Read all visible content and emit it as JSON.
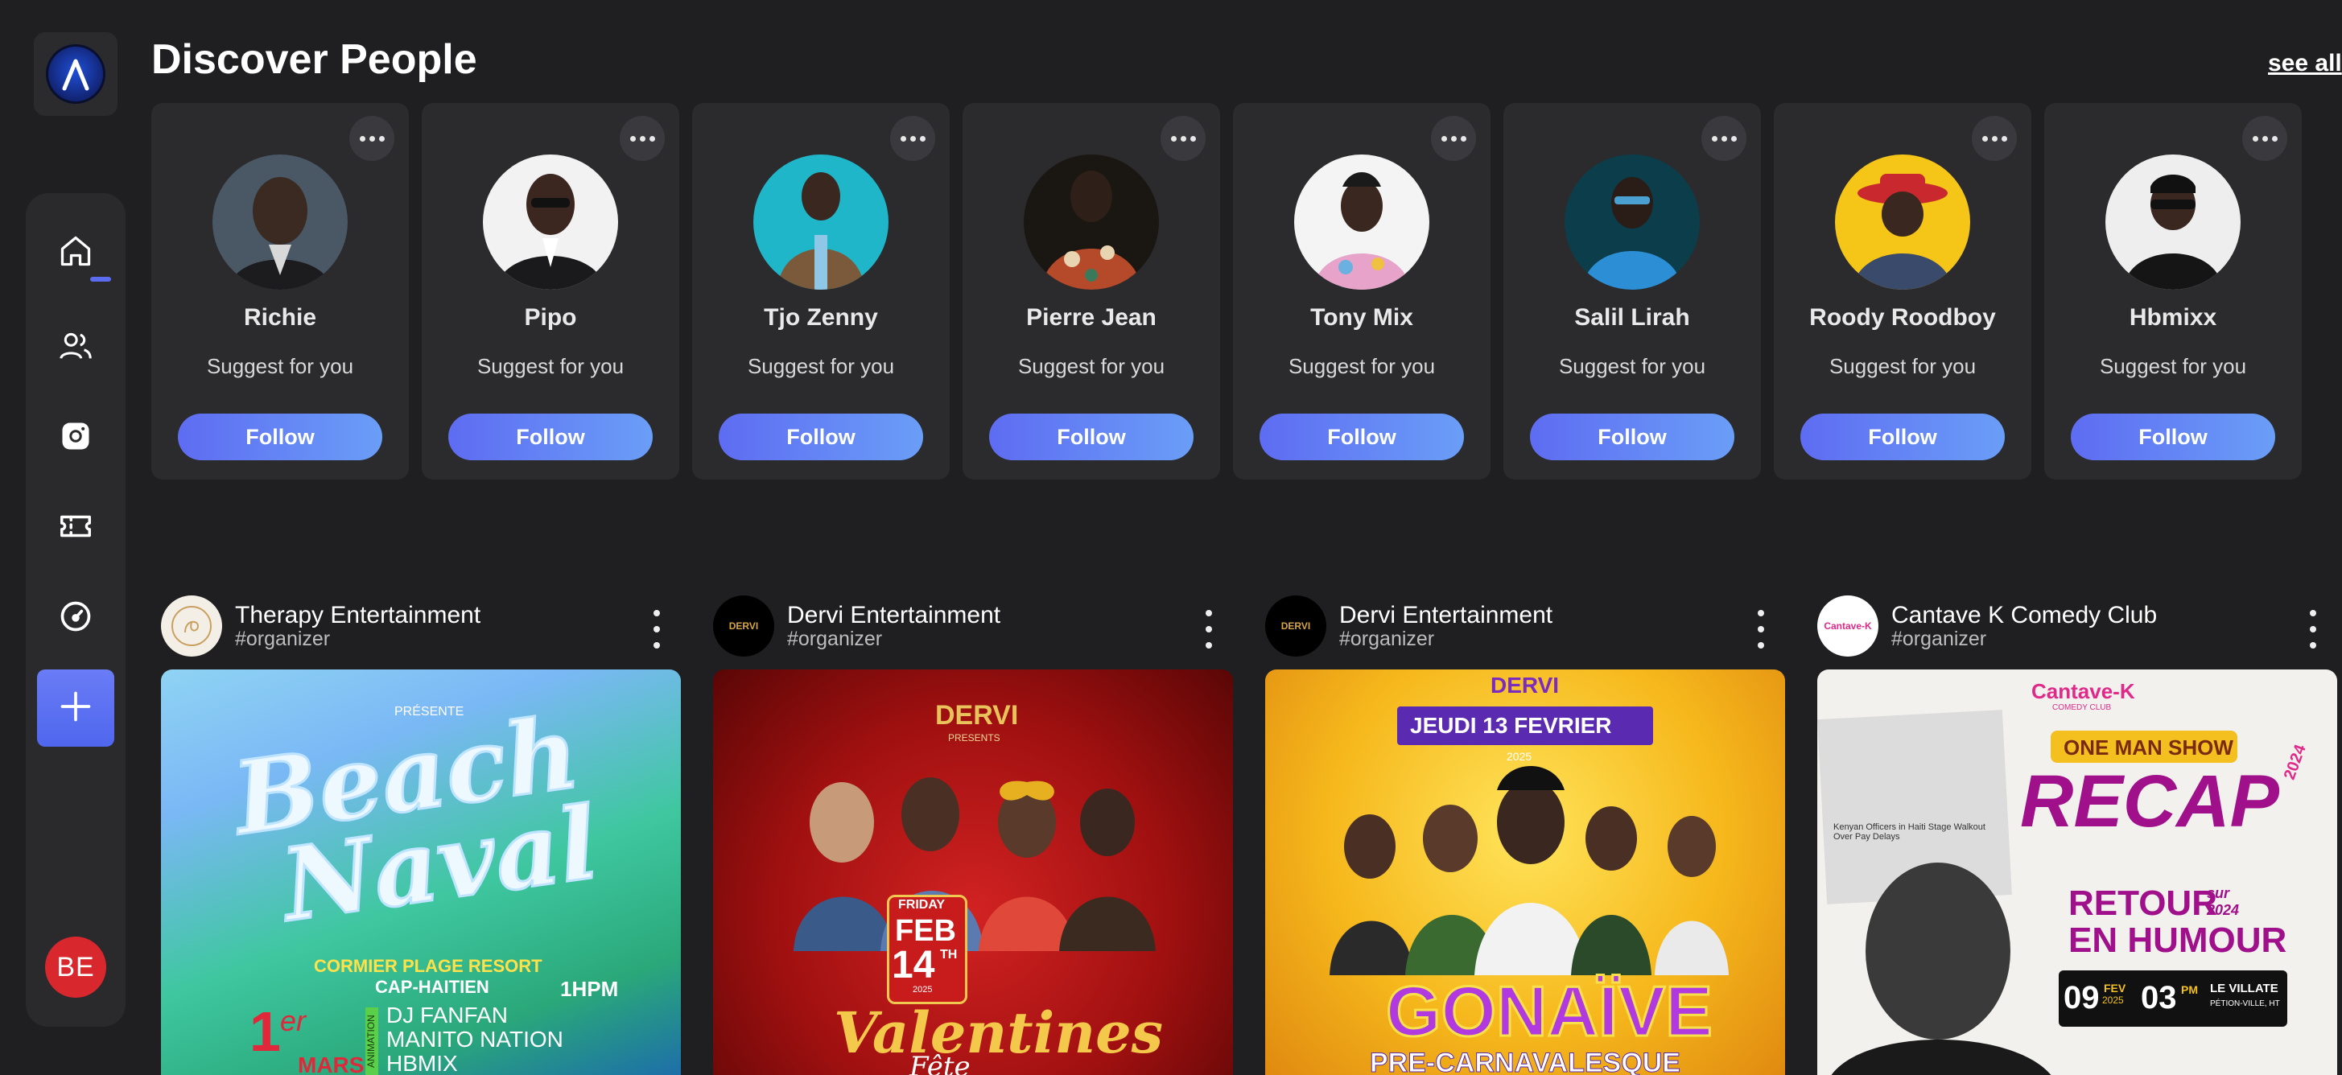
{
  "header": {
    "title": "Discover People",
    "see_all": "see all"
  },
  "sidebar": {
    "items": [
      {
        "icon": "home-icon",
        "active": true
      },
      {
        "icon": "users-icon"
      },
      {
        "icon": "camera-icon"
      },
      {
        "icon": "ticket-icon"
      },
      {
        "icon": "gauge-icon"
      }
    ],
    "add_icon": "plus-icon",
    "user_initials": "BE"
  },
  "people": [
    {
      "name": "Richie",
      "subtitle": "Suggest for you",
      "button": "Follow"
    },
    {
      "name": "Pipo",
      "subtitle": "Suggest for you",
      "button": "Follow"
    },
    {
      "name": "Tjo Zenny",
      "subtitle": "Suggest for you",
      "button": "Follow"
    },
    {
      "name": "Pierre Jean",
      "subtitle": "Suggest for you",
      "button": "Follow"
    },
    {
      "name": "Tony Mix",
      "subtitle": "Suggest for you",
      "button": "Follow"
    },
    {
      "name": "Salil Lirah",
      "subtitle": "Suggest for you",
      "button": "Follow"
    },
    {
      "name": "Roody Roodboy",
      "subtitle": "Suggest for you",
      "button": "Follow"
    },
    {
      "name": "Hbmixx",
      "subtitle": "Suggest for you",
      "button": "Follow"
    }
  ],
  "posts": [
    {
      "organizer": "Therapy Entertainment",
      "tag": "#organizer",
      "poster": {
        "line1": "Beach",
        "line2": "Naval",
        "presents": "PRÉSENTE",
        "venue": "CORMIER PLAGE RESORT",
        "city": "CAP-HAITIEN",
        "time": "1HPM",
        "date_num": "1",
        "date_sup": "er",
        "month": "MARS",
        "side_label": "ANIMATION",
        "acts": [
          "DJ FANFAN",
          "MANITO NATION",
          "HBMIX"
        ]
      }
    },
    {
      "organizer": "Dervi Entertainment",
      "tag": "#organizer",
      "poster": {
        "brand": "DERVI",
        "presents": "PRESENTS",
        "day": "FRIDAY",
        "month": "FEB",
        "date": "14",
        "date_sup": "TH",
        "year": "2025",
        "title": "Valentines",
        "subtitle": "Fête"
      }
    },
    {
      "organizer": "Dervi Entertainment",
      "tag": "#organizer",
      "poster": {
        "brand": "DERVI",
        "date_banner": "JEUDI 13 FEVRIER",
        "year": "2025",
        "title": "GONAÏVE",
        "subtitle": "PRE-CARNAVALESQUE"
      }
    },
    {
      "organizer": "Cantave K Comedy Club",
      "tag": "#organizer",
      "poster": {
        "brand": "Cantave-K",
        "brand_sub": "COMEDY CLUB",
        "banner": "ONE MAN SHOW",
        "title": "RECAP",
        "year": "2024",
        "line1": "RETOUR",
        "line1_sup": "sur 2024",
        "line2": "EN HUMOUR",
        "date_day": "09",
        "date_month": "FEV",
        "date_year": "2025",
        "time": "03",
        "time_unit": "PM",
        "venue": "LE VILLATE",
        "venue_city": "PÉTION-VILLE, HT",
        "clip_text": "Kenyan Officers in Haiti Stage Walkout Over Pay Delays"
      }
    }
  ],
  "colors": {
    "background": "#1f1f21",
    "card": "#2b2b2e",
    "accent": "#5e6cf2",
    "avatar": "#d8282e"
  }
}
